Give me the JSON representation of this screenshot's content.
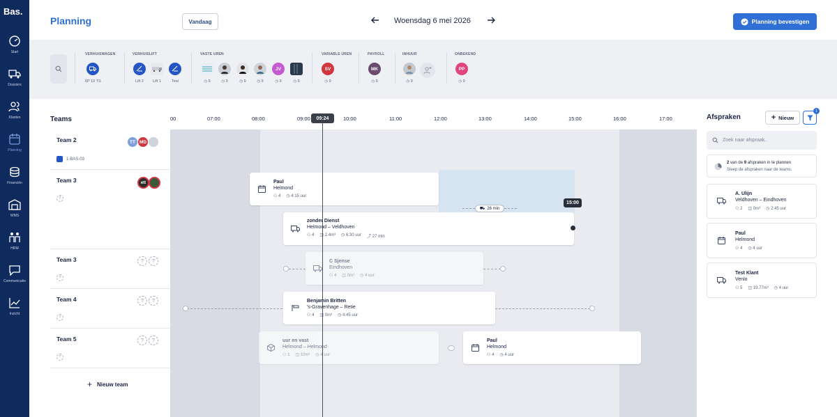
{
  "app": {
    "logo": "Bas."
  },
  "nav": [
    {
      "label": "Start",
      "icon": "speedometer-icon"
    },
    {
      "label": "Dossiers",
      "icon": "truck-icon"
    },
    {
      "label": "Klanten",
      "icon": "users-icon"
    },
    {
      "label": "Planning",
      "icon": "calendar-icon",
      "active": true
    },
    {
      "label": "Financiën",
      "icon": "coins-icon"
    },
    {
      "label": "WMS",
      "icon": "warehouse-icon"
    },
    {
      "label": "HRM",
      "icon": "people-icon"
    },
    {
      "label": "Communicatie",
      "icon": "chat-icon"
    },
    {
      "label": "Inzicht",
      "icon": "chart-icon"
    }
  ],
  "header": {
    "title": "Planning",
    "today_label": "Vandaag",
    "date": "Woensdag 6 mei 2026",
    "confirm_label": "Planning bevestigen"
  },
  "resources": {
    "groups": [
      "VERHUISWAGEN",
      "VERHUISLIFT",
      "VASTE UREN",
      "VARIABLE UREN",
      "PAYROLL",
      "INHUUR",
      "ONBEKEND"
    ],
    "vehicles": [
      {
        "label": "XP 10 TS"
      }
    ],
    "lifts": [
      {
        "label": "Lift 2"
      },
      {
        "label": "Lift 1"
      },
      {
        "label": "Test"
      }
    ],
    "fixed": [
      {
        "count": "9"
      },
      {
        "count": "9"
      },
      {
        "count": "9"
      },
      {
        "count": "9"
      },
      {
        "initials": "JV",
        "count": "9",
        "color": "#c45bd0"
      },
      {
        "count": "9"
      }
    ],
    "variable": [
      {
        "initials": "SV",
        "count": "9",
        "color": "#d2363f"
      }
    ],
    "payroll": [
      {
        "initials": "MK",
        "count": "9",
        "color": "#6a4a6e"
      }
    ],
    "hire": [
      {
        "count": "9"
      }
    ],
    "unknown": [
      {
        "initials": "PP",
        "count": "9",
        "color": "#e0457f"
      }
    ]
  },
  "timeline": {
    "hours": [
      "00",
      "07:00",
      "08:00",
      "09:00",
      "10:00",
      "11:00",
      "12:00",
      "13:00",
      "14:00",
      "15:00",
      "16:00",
      "17:00"
    ],
    "now": "09:24",
    "end_label": "15:00",
    "travel": "26 min"
  },
  "teams": {
    "heading": "Teams",
    "rows": [
      {
        "name": "Team 2",
        "vehicle": "1-BAS-03",
        "initials1": "TT",
        "initials2": "MD"
      },
      {
        "name": "Team 3",
        "initials1": "ett"
      },
      {
        "name": "Team 3"
      },
      {
        "name": "Team 4"
      },
      {
        "name": "Team 5"
      }
    ],
    "new_label": "Nieuw team"
  },
  "jobs": [
    {
      "title": "Paul",
      "place": "Helmond",
      "people": "4",
      "hours": "4:15 uur"
    },
    {
      "title": "zonder Dienst",
      "place": "Helmond – Veldhoven",
      "people": "4",
      "volume": "2.4m³",
      "hours": "6:30 uur",
      "travel": "27 min"
    },
    {
      "title": "C Sjense",
      "place": "Eindhoven",
      "people": "4",
      "volume": "0m³",
      "hours": "4 uur"
    },
    {
      "title": "Benjamin Britten",
      "place": "'s-Gravenhage – Retie",
      "people": "4",
      "volume": "0m³",
      "hours": "4:45 uur"
    },
    {
      "title": "uur en vast",
      "place": "Helmond – Helmond",
      "people": "1",
      "volume": "10m³",
      "hours": "4 uur"
    },
    {
      "title": "Paul",
      "place": "Helmond",
      "people": "4",
      "hours": "4 uur"
    }
  ],
  "appointments": {
    "title": "Afspraken",
    "new_label": "Nieuw",
    "filter_badge": "1",
    "search_placeholder": "Zoek naar afspraak..",
    "info_count": "2",
    "info_total": "9",
    "info_line1_pre": "van de",
    "info_line1_post": "afspraken in te plannen",
    "info_line2": "Sleep de afspraken naar de teams.",
    "items": [
      {
        "title": "A. Ulijn",
        "place": "Veldhoven – Eindhoven",
        "people": "2",
        "volume": "0m³",
        "hours": "2:45 uur",
        "icon": "truck-icon"
      },
      {
        "title": "Paul",
        "place": "Helmond",
        "people": "4",
        "hours": "4 uur",
        "icon": "calendar-icon"
      },
      {
        "title": "Test Klant",
        "place": "Venlo",
        "people": "5",
        "volume": "19.77m³",
        "hours": "4 uur",
        "icon": "truck-icon"
      }
    ]
  },
  "colors": {
    "primary": "#2f6fd6",
    "sidebar": "#0f2a5c",
    "timeline_bg": "#e6e8ef"
  }
}
